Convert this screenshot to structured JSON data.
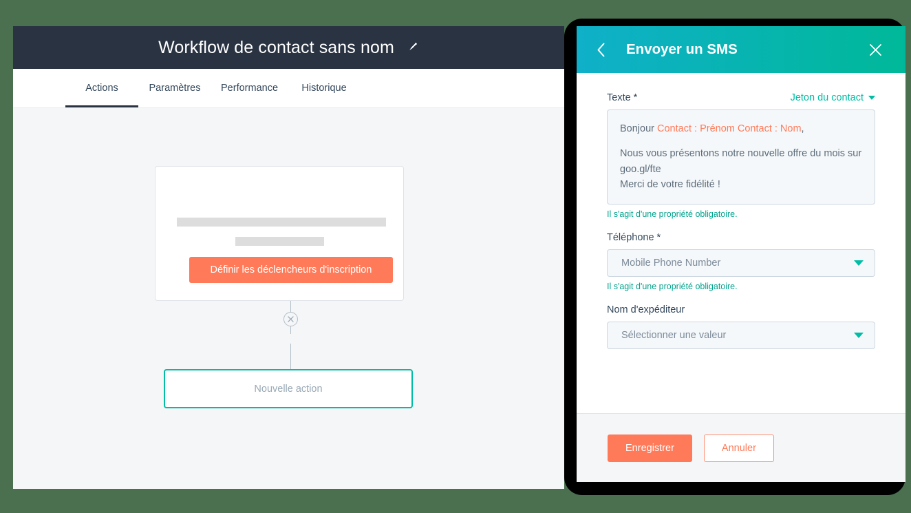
{
  "theme": {
    "page_background": "#4a7050",
    "header_navy": "#2a3342",
    "accent_orange": "#ff7a59",
    "accent_teal": "#00bda5",
    "panel_gradient_from": "#0fb0c9",
    "panel_gradient_to": "#00b899",
    "canvas_background": "#f4f6f8"
  },
  "app": {
    "title": "Workflow de contact sans nom",
    "edit_icon": "pencil-icon",
    "tabs": [
      {
        "label": "Actions",
        "active": true
      },
      {
        "label": "Paramètres",
        "active": false
      },
      {
        "label": "Performance",
        "active": false
      },
      {
        "label": "Historique",
        "active": false
      }
    ]
  },
  "canvas": {
    "trigger_card": {
      "placeholder_bars": 2,
      "button_label": "Définir les déclencheurs d'inscription"
    },
    "connector": {
      "icon": "close-circle-icon"
    },
    "new_action": {
      "label": "Nouvelle action"
    }
  },
  "panel": {
    "back_icon": "chevron-left-icon",
    "title": "Envoyer un SMS",
    "close_icon": "close-icon",
    "text_field": {
      "label": "Texte *",
      "token_link": "Jeton du contact",
      "token_caret": "chevron-down-icon",
      "value_line1_prefix": "Bonjour ",
      "value_line1_token": "Contact : Prénom Contact : Nom",
      "value_line1_suffix": ",",
      "value_line2": "Nous vous présentons notre nouvelle offre du mois sur goo.gl/fte",
      "value_line3": "Merci de votre fidélité !",
      "help_text": "Il s'agit d'une propriété obligatoire."
    },
    "phone_field": {
      "label": "Téléphone *",
      "value": "Mobile Phone Number",
      "placeholder": "Sélectionner une valeur",
      "caret": "chevron-down-icon",
      "help_text": "Il s'agit d'une propriété obligatoire."
    },
    "sender_field": {
      "label": "Nom d'expéditeur",
      "value": "Sélectionner une valeur",
      "placeholder": "Sélectionner une valeur",
      "caret": "chevron-down-icon"
    },
    "footer": {
      "save_label": "Enregistrer",
      "cancel_label": "Annuler"
    }
  }
}
